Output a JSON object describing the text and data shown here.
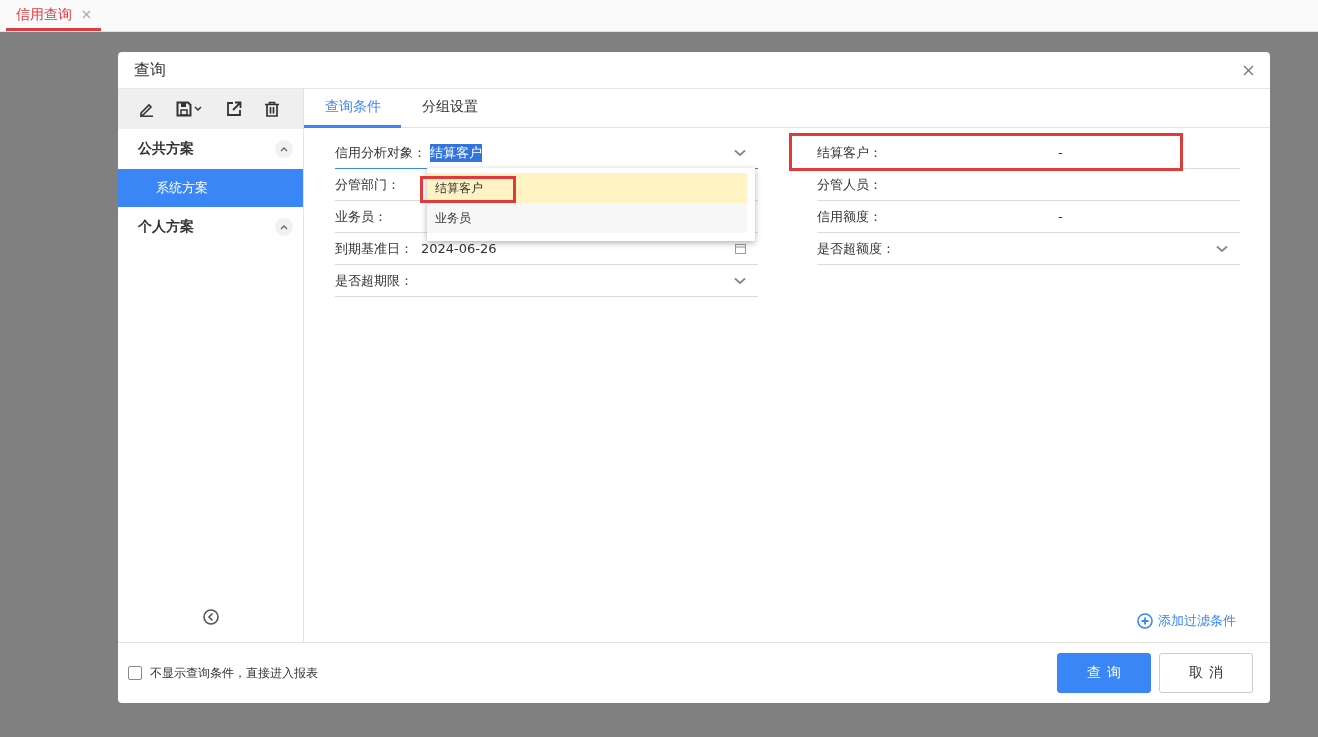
{
  "tab_bar": {
    "tabs": [
      {
        "label": "信用查询",
        "selected": true
      }
    ]
  },
  "dialog": {
    "title": "查询",
    "sidebar": {
      "groups": [
        {
          "label": "公共方案",
          "expanded": true,
          "children": [
            {
              "label": "系统方案",
              "selected": true
            }
          ]
        },
        {
          "label": "个人方案",
          "expanded": true
        }
      ]
    },
    "tabs": [
      {
        "label": "查询条件",
        "selected": true
      },
      {
        "label": "分组设置",
        "selected": false
      }
    ],
    "fields_left": [
      {
        "label": "信用分析对象：",
        "value": "结算客户",
        "kind": "select",
        "focused": true
      },
      {
        "label": "分管部门：",
        "kind": "text",
        "focused": false
      },
      {
        "label": "业务员：",
        "kind": "text",
        "focused": false
      },
      {
        "label": "到期基准日：",
        "value": "2024-06-26",
        "kind": "date",
        "focused": false
      },
      {
        "label": "是否超期限：",
        "kind": "select",
        "focused": false
      }
    ],
    "fields_right": [
      {
        "label": "结算客户：",
        "value": "-",
        "kind": "text",
        "highlighted": true
      },
      {
        "label": "分管人员：",
        "kind": "text",
        "highlighted": false
      },
      {
        "label": "信用额度：",
        "value": "-",
        "kind": "text",
        "highlighted": false
      },
      {
        "label": "是否超额度：",
        "kind": "select",
        "highlighted": false
      }
    ],
    "dropdown": {
      "options": [
        {
          "label": "结算客户",
          "selected": true,
          "highlighted": true
        },
        {
          "label": "业务员",
          "selected": false,
          "highlighted": false
        }
      ]
    },
    "add_filter": "添加过滤条件",
    "skip_checkbox": {
      "label": "不显示查询条件，直接进入报表",
      "checked": false
    },
    "buttons": [
      {
        "label": "查询",
        "kind": "primary"
      },
      {
        "label": "取消",
        "kind": "default"
      }
    ]
  }
}
